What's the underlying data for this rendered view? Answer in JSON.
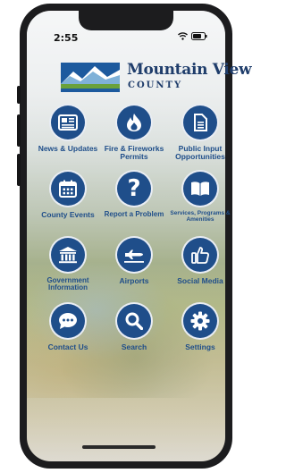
{
  "status": {
    "time": "2:55"
  },
  "brand": {
    "name": "Mountain View",
    "subtitle": "COUNTY"
  },
  "colors": {
    "primary": "#1f4e8a",
    "brand_text": "#1f3d6b"
  },
  "tiles": [
    {
      "label": "News & Updates",
      "icon": "newspaper-icon"
    },
    {
      "label": "Fire & Fireworks Permits",
      "icon": "flame-icon"
    },
    {
      "label": "Public Input Opportunities",
      "icon": "document-icon"
    },
    {
      "label": "County Events",
      "icon": "calendar-icon"
    },
    {
      "label": "Report a Problem",
      "icon": "question-icon"
    },
    {
      "label": "Services, Programs & Amenities",
      "icon": "book-icon"
    },
    {
      "label": "Government Information",
      "icon": "government-building-icon"
    },
    {
      "label": "Airports",
      "icon": "airplane-icon"
    },
    {
      "label": "Social Media",
      "icon": "thumbs-up-icon"
    },
    {
      "label": "Contact Us",
      "icon": "chat-icon"
    },
    {
      "label": "Search",
      "icon": "search-icon"
    },
    {
      "label": "Settings",
      "icon": "gear-icon"
    }
  ]
}
